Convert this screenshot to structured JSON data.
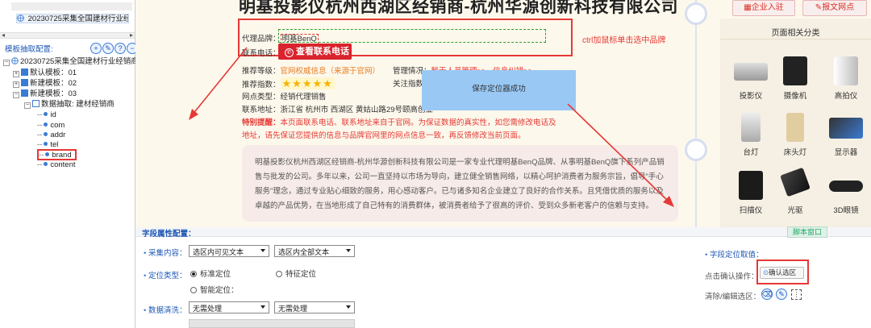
{
  "tree": {
    "top_item": "20230725采集全国建材行业经销",
    "panel_title": "模板抽取配置:",
    "root": "20230725采集全国建材行业经销商网",
    "templates": [
      "默认模板：01",
      "新建模板：02",
      "新建模板：03"
    ],
    "extract_node": "数据抽取: 建材经销商",
    "fields": [
      "id",
      "com",
      "addr",
      "tel",
      "brand",
      "content"
    ]
  },
  "page": {
    "title": "明基投影仪杭州西湖区经销商-杭州华源创新科技有限公司",
    "brand_label": "代理品牌：",
    "brand_value": "明基BenQ",
    "phone_label": "联系电话：",
    "call_button": "查看联系电话",
    "ctrl_hint": "ctrl加鼠标单击选中品牌",
    "rec_label": "推荐等级：",
    "rec_value": "官网权威信息（来源于官网）",
    "mgmt_label": "管理情况：",
    "mgmt_value": "暂无人员管理>>",
    "error_link": "信息纠错>>",
    "index_label": "推荐指数：",
    "stars": "★★★★★",
    "follow_label": "关注指数",
    "type_label": "网点类型：",
    "type_value": "经销代理销售",
    "addr_label": "联系地址：",
    "addr_value": "浙江省 杭州市 西湖区 黄姑山路29号颐高创业",
    "special_label": "特别提醒：",
    "special_text1": "本页面联系电话、联系地址来自于官网。为保证数据的真实性，如您需修改电话及",
    "special_text2": "地址，请先保证您提供的信息与品牌官网里的网点信息一致，再反馈修改当前页面。",
    "description": "明基投影仪杭州西湖区经销商-杭州华源创新科技有限公司是一家专业代理明基BenQ品牌、从事明基BenQ旗下系列产品销售与批发的公司。多年以来，公司一直坚持以市场为导向，建立健全销售网络，以精心呵护消费者为服务宗旨，倡导\"手心服务\"理念，通过专业贴心细致的服务，用心感动客户。已与诸多知名企业建立了良好的合作关系。且凭借优质的服务以及卓越的产品优势，在当地形成了自己特有的消费群体，被消费者给予了很高的评价、受到众多新老客户的信赖与支持。",
    "toast": "保存定位器成功",
    "enterprise_btn": "企业入驻",
    "report_btn": "报文网点",
    "side_title": "页面相关分类",
    "categories": [
      "投影仪",
      "摄像机",
      "高拍仪",
      "台灯",
      "床头灯",
      "显示器",
      "扫描仪",
      "光驱",
      "3D眼镜"
    ]
  },
  "config": {
    "header": "字段属性配置：",
    "script_btn": "脚本窗口",
    "collect_label": "采集内容：",
    "collect_sel1": "选区内可见文本",
    "collect_sel2": "选区内全部文本",
    "locate_label": "定位类型：",
    "opt_standard": "标准定位",
    "opt_feature": "特征定位",
    "opt_smart": "智能定位：",
    "clean_label": "数据清洗：",
    "clean_sel1": "无需处理",
    "clean_sel2": "无需处理",
    "field_locate": "字段定位取值：",
    "confirm_label": "点击确认操作：",
    "confirm_btn": "确认选区",
    "clear_label": "清除/编辑选区："
  },
  "colors": {
    "accent_red": "#e53935",
    "link_blue": "#1e57b6",
    "toast_bg": "#99c8f5"
  }
}
